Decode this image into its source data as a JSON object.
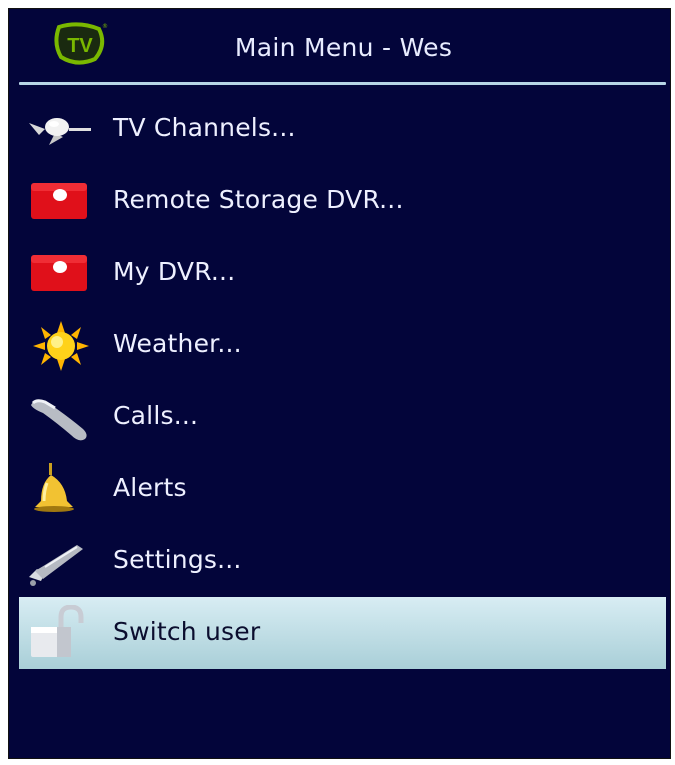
{
  "header": {
    "logo_text": "TV",
    "title": "Main Menu - Wes"
  },
  "menu": {
    "items": [
      {
        "label": "TV Channels...",
        "icon": "satellite-icon"
      },
      {
        "label": "Remote Storage DVR...",
        "icon": "record-icon"
      },
      {
        "label": "My DVR...",
        "icon": "record-icon"
      },
      {
        "label": "Weather...",
        "icon": "sun-icon"
      },
      {
        "label": "Calls...",
        "icon": "phone-handset-icon"
      },
      {
        "label": "Alerts",
        "icon": "bell-icon"
      },
      {
        "label": "Settings...",
        "icon": "wrench-icon"
      },
      {
        "label": "Switch user",
        "icon": "unlocked-padlock-icon"
      }
    ],
    "selected_index": 7
  },
  "colors": {
    "background": "#03053a",
    "text": "#eef0ff",
    "rule": "#b8d6e6",
    "selection": "#bfe0e8",
    "logo_green": "#7ab800",
    "record_red": "#e0101a",
    "sun_yellow": "#ffd21a"
  }
}
